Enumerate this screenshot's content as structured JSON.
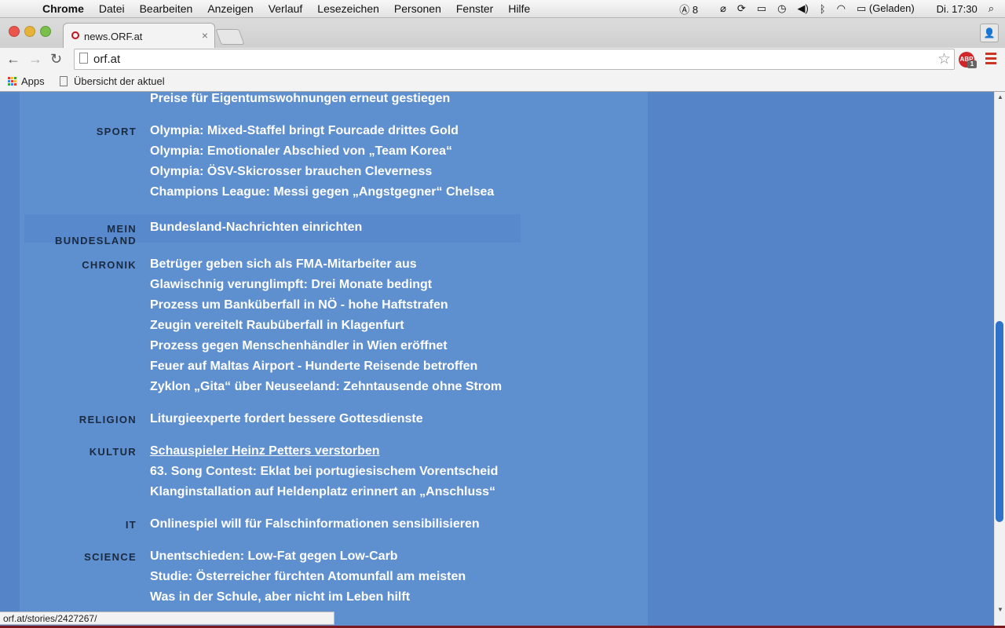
{
  "menubar": {
    "app": "Chrome",
    "menus": [
      "Datei",
      "Bearbeiten",
      "Anzeigen",
      "Verlauf",
      "Lesezeichen",
      "Personen",
      "Fenster",
      "Hilfe"
    ],
    "adobe_count": "8",
    "battery": "(Geladen)",
    "clock": "Di. 17:30"
  },
  "tab": {
    "title": "news.ORF.at",
    "close": "×"
  },
  "toolbar": {
    "url": "orf.at",
    "abp_label": "ABP",
    "abp_count": "1"
  },
  "bookmarks": {
    "apps": "Apps",
    "item": "Übersicht der aktuel"
  },
  "sections": [
    {
      "label": "",
      "items": [
        "Preise für Eigentumswohnungen erneut gestiegen"
      ]
    },
    {
      "label": "SPORT",
      "items": [
        "Olympia: Mixed-Staffel bringt Fourcade drittes Gold",
        "Olympia: Emotionaler Abschied von „Team Korea“",
        "Olympia: ÖSV-Skicrosser brauchen Cleverness",
        "Champions League: Messi gegen „Angstgegner“ Chelsea"
      ]
    },
    {
      "label": "MEIN BUNDESLAND",
      "items": [
        "Bundesland-Nachrichten einrichten"
      ]
    },
    {
      "label": "CHRONIK",
      "items": [
        "Betrüger geben sich als FMA-Mitarbeiter aus",
        "Glawischnig verunglimpft: Drei Monate bedingt",
        "Prozess um Banküberfall in NÖ - hohe Haftstrafen",
        "Zeugin vereitelt Raubüberfall in Klagenfurt",
        "Prozess gegen Menschenhändler in Wien eröffnet",
        "Feuer auf Maltas Airport - Hunderte Reisende betroffen",
        "Zyklon „Gita“ über Neuseeland: Zehntausende ohne Strom"
      ]
    },
    {
      "label": "RELIGION",
      "items": [
        "Liturgieexperte fordert bessere Gottesdienste"
      ]
    },
    {
      "label": "KULTUR",
      "items": [
        "Schauspieler Heinz Petters verstorben",
        "63. Song Contest: Eklat bei portugiesischem Vorentscheid",
        "Klanginstallation auf Heldenplatz erinnert an „Anschluss“"
      ]
    },
    {
      "label": "IT",
      "items": [
        "Onlinespiel will für Falschinformationen sensibilisieren"
      ]
    },
    {
      "label": "SCIENCE",
      "items": [
        "Unentschieden: Low-Fat gegen Low-Carb",
        "Studie: Österreicher fürchten Atomunfall am meisten",
        "Was in der Schule, aber nicht im Leben hilft"
      ]
    }
  ],
  "statusbar": {
    "url": "orf.at/stories/2427267/"
  },
  "colors": {
    "page_bg": "#5585c8",
    "column_bg": "#5e8fcf",
    "headline": "#ffffff",
    "section_label": "#1a2a40"
  }
}
